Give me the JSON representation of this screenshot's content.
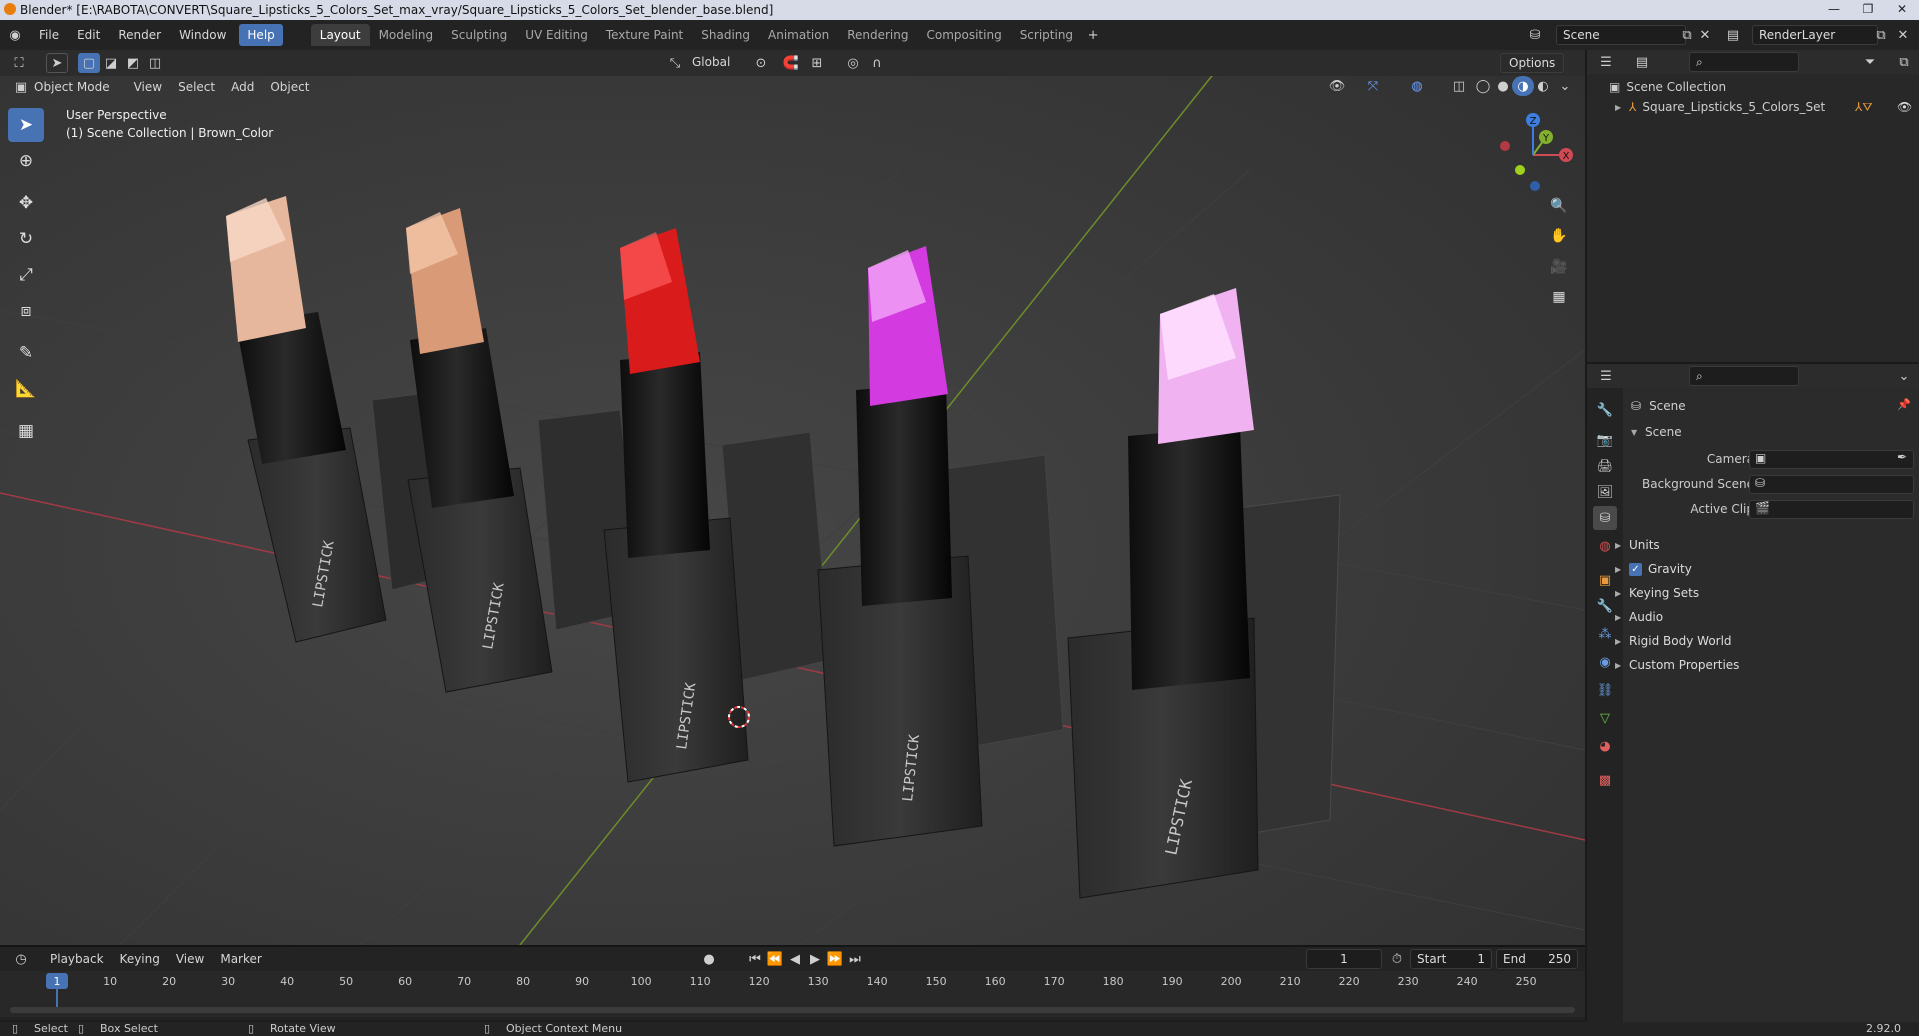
{
  "app": {
    "title": "Blender* [E:\\RABOTA\\CONVERT\\Square_Lipsticks_5_Colors_Set_max_vray/Square_Lipsticks_5_Colors_Set_blender_base.blend]",
    "version": "2.92.0"
  },
  "menu": [
    "File",
    "Edit",
    "Render",
    "Window",
    "Help"
  ],
  "workspaces": {
    "tabs": [
      "Layout",
      "Modeling",
      "Sculpting",
      "UV Editing",
      "Texture Paint",
      "Shading",
      "Animation",
      "Rendering",
      "Compositing",
      "Scripting"
    ],
    "active": "Layout",
    "add_icon": "plus-icon"
  },
  "scene_selector": {
    "scene": "Scene",
    "render_layer": "RenderLayer"
  },
  "viewport": {
    "mode": "Object Mode",
    "header_menus": [
      "View",
      "Select",
      "Add",
      "Object"
    ],
    "transform_orientation": "Global",
    "options_label": "Options",
    "perspective_label": "User Perspective",
    "collection_label": "(1) Scene Collection | Brown_Color",
    "gizmo_axes": [
      "X",
      "Y",
      "Z"
    ],
    "accent": "#4772b3",
    "x_axis_color": "#c4434f",
    "y_axis_color": "#7fa32e"
  },
  "lipsticks": [
    {
      "label": "LIPSTICK",
      "bullet_color": "#e6b79d"
    },
    {
      "label": "LIPSTICK",
      "bullet_color": "#d99b77"
    },
    {
      "label": "LIPSTICK",
      "bullet_color": "#d91b1b"
    },
    {
      "label": "LIPSTICK",
      "bullet_color": "#d33ae0"
    },
    {
      "label": "LIPSTICK",
      "bullet_color": "#f0b2f0"
    }
  ],
  "outliner": {
    "root": "Scene Collection",
    "items": [
      {
        "label": "Square_Lipsticks_5_Colors_Set"
      }
    ]
  },
  "properties": {
    "context": "Scene",
    "panel_title": "Scene",
    "fields": [
      {
        "label": "Camera",
        "value": ""
      },
      {
        "label": "Background Scene",
        "value": ""
      },
      {
        "label": "Active Clip",
        "value": ""
      }
    ],
    "sections": [
      {
        "label": "Units",
        "checkbox": false
      },
      {
        "label": "Gravity",
        "checkbox": true
      },
      {
        "label": "Keying Sets",
        "checkbox": false
      },
      {
        "label": "Audio",
        "checkbox": false
      },
      {
        "label": "Rigid Body World",
        "checkbox": false
      },
      {
        "label": "Custom Properties",
        "checkbox": false
      }
    ]
  },
  "timeline": {
    "menus": [
      "Playback",
      "Keying",
      "View",
      "Marker"
    ],
    "current_frame": "1",
    "start_label": "Start",
    "start": "1",
    "end_label": "End",
    "end": "250",
    "ticks": [
      "1",
      "10",
      "20",
      "30",
      "40",
      "50",
      "60",
      "70",
      "80",
      "90",
      "100",
      "110",
      "120",
      "130",
      "140",
      "150",
      "160",
      "170",
      "180",
      "190",
      "200",
      "210",
      "220",
      "230",
      "240",
      "250"
    ]
  },
  "statusbar": {
    "items": [
      "Select",
      "Box Select",
      "Rotate View",
      "Object Context Menu"
    ]
  }
}
